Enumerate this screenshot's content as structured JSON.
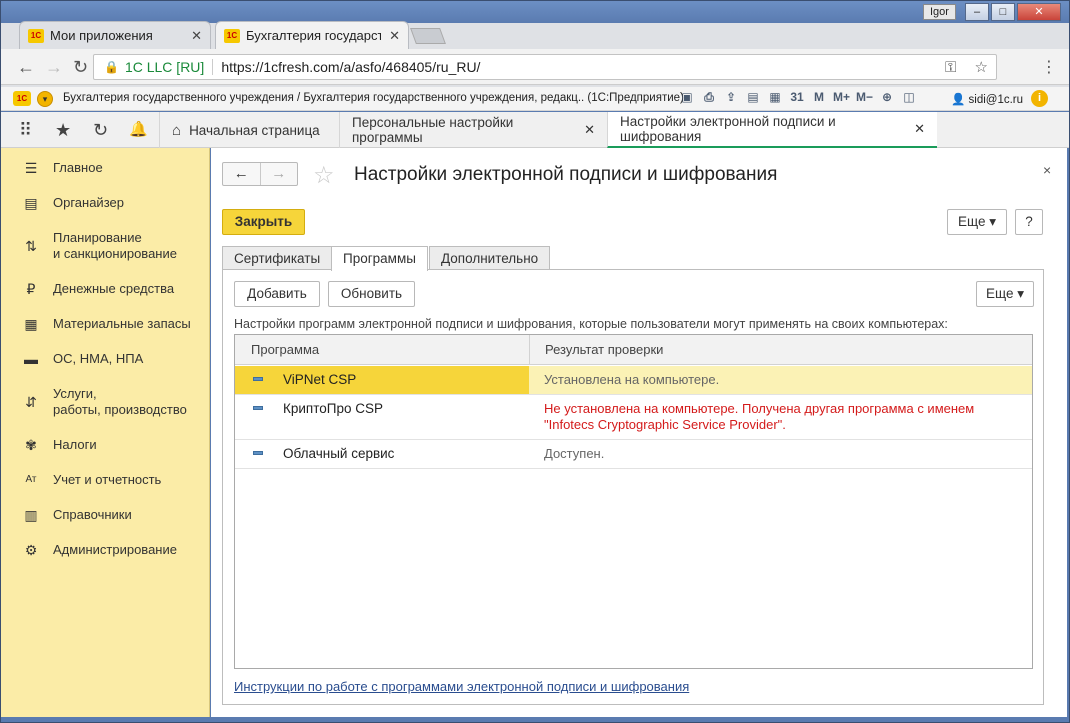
{
  "window": {
    "user": "Igor",
    "min": "–",
    "max": "□",
    "close": "✕"
  },
  "browser": {
    "tabs": [
      {
        "logo": "1С",
        "label": "Мои приложения",
        "close": "✕"
      },
      {
        "logo": "1С",
        "label": "Бухгалтерия государстве",
        "close": "✕"
      }
    ],
    "nav": {
      "back": "←",
      "forward": "→",
      "reload": "↻"
    },
    "address": {
      "lock": "🔒",
      "secure_label": "1C LLC [RU]",
      "url": "https://1cfresh.com/a/asfo/468405/ru_RU/",
      "key": "⚿",
      "star": "☆"
    },
    "menu": "⋮"
  },
  "toolbar1c": {
    "logo": "1С",
    "caption": "Бухгалтерия государственного учреждения / Бухгалтерия государственного учреждения, редакц.. (1С:Предприятие)",
    "tools": [
      "▣",
      "⎙",
      "⇪",
      "▤",
      "▦",
      "31",
      "M",
      "M+",
      "M−",
      "⊕",
      "◫"
    ],
    "user": "sidi@1c.ru",
    "info": "i"
  },
  "sections": {
    "icons": {
      "apps": "⠿",
      "fav": "★",
      "history": "↻",
      "bell": "🔔"
    },
    "tabs": [
      {
        "label": "Начальная страница",
        "icon": "⌂"
      },
      {
        "label": "Персональные настройки программы",
        "close": "✕"
      },
      {
        "label": "Настройки электронной подписи и шифрования",
        "close": "✕"
      }
    ]
  },
  "sidebar": {
    "items": [
      {
        "icon": "☰",
        "label": "Главное"
      },
      {
        "icon": "▤",
        "label": "Органайзер"
      },
      {
        "icon": "⇅",
        "label": "Планирование\nи санкционирование"
      },
      {
        "icon": "₽",
        "label": "Денежные средства"
      },
      {
        "icon": "▦",
        "label": "Материальные запасы"
      },
      {
        "icon": "▬",
        "label": "ОС, НМА, НПА"
      },
      {
        "icon": "⇵",
        "label": "Услуги,\nработы, производство"
      },
      {
        "icon": "✾",
        "label": "Налоги"
      },
      {
        "icon": "Ат",
        "label": "Учет и отчетность"
      },
      {
        "icon": "▥",
        "label": "Справочники"
      },
      {
        "icon": "⚙",
        "label": "Администрирование"
      }
    ]
  },
  "form": {
    "nav": {
      "back": "←",
      "forward": "→"
    },
    "star": "☆",
    "title": "Настройки электронной подписи и шифрования",
    "close_x": "×",
    "close_btn": "Закрыть",
    "more": "Еще ▾",
    "help": "?",
    "tabs": [
      "Сертификаты",
      "Программы",
      "Дополнительно"
    ],
    "panel": {
      "add": "Добавить",
      "refresh": "Обновить",
      "more": "Еще ▾",
      "description": "Настройки программ электронной подписи и шифрования, которые пользователи могут применять на своих компьютерах:",
      "columns": [
        "Программа",
        "Результат проверки"
      ],
      "rows": [
        {
          "name": "ViPNet CSP",
          "result": "Установлена на компьютере."
        },
        {
          "name": "КриптоПро CSP",
          "result": "Не установлена на компьютере. Получена другая программа с именем \"Infotecs Cryptographic Service Provider\"."
        },
        {
          "name": "Облачный сервис",
          "result": "Доступен."
        }
      ],
      "link": "Инструкции по работе с программами электронной подписи и шифрования"
    }
  }
}
